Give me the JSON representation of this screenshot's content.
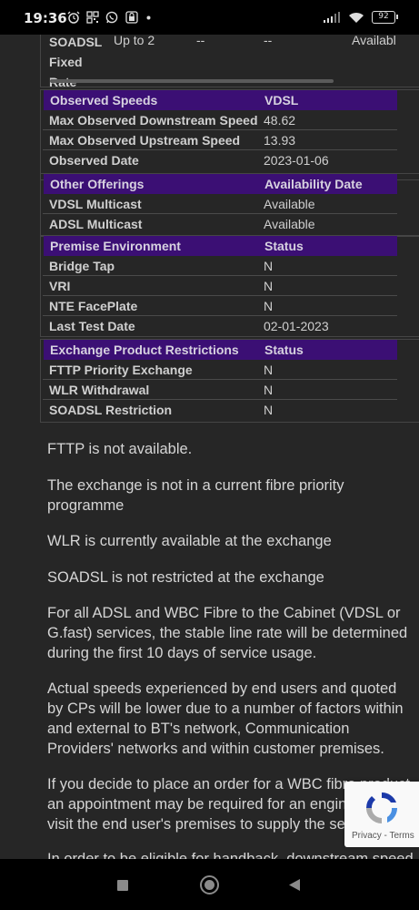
{
  "status_bar": {
    "time": "19:36",
    "battery": "92"
  },
  "top_row": {
    "label_lines": [
      "SOADSL",
      "Fixed",
      "Rate"
    ],
    "value": "Up to 2",
    "col3": "--",
    "col4": "--",
    "col5": "Availabl"
  },
  "observed": {
    "headers": [
      "Observed Speeds",
      "VDSL"
    ],
    "rows": [
      [
        "Max Observed Downstream Speed",
        "48.62"
      ],
      [
        "Max Observed Upstream Speed",
        "13.93"
      ],
      [
        "Observed Date",
        "2023-01-06"
      ]
    ]
  },
  "offerings": {
    "headers": [
      "Other Offerings",
      "Availability Date"
    ],
    "rows": [
      [
        "VDSL Multicast",
        "Available"
      ],
      [
        "ADSL Multicast",
        "Available"
      ]
    ]
  },
  "premise": {
    "headers": [
      "Premise Environment",
      "Status"
    ],
    "rows": [
      [
        "Bridge Tap",
        "N"
      ],
      [
        "VRI",
        "N"
      ],
      [
        "NTE FacePlate",
        "N"
      ],
      [
        "Last Test Date",
        "02-01-2023"
      ]
    ]
  },
  "exchange": {
    "headers": [
      "Exchange Product Restrictions",
      "Status"
    ],
    "rows": [
      [
        "FTTP Priority Exchange",
        "N"
      ],
      [
        "WLR Withdrawal",
        "N"
      ],
      [
        "SOADSL Restriction",
        "N"
      ]
    ]
  },
  "paragraphs": [
    "FTTP is not available.",
    "The exchange is not in a current fibre priority programme",
    "WLR is currently available at the exchange",
    "SOADSL is not restricted at the exchange",
    "For all ADSL and WBC Fibre to the Cabinet (VDSL or G.fast) services, the stable line rate will be determined during the first 10 days of service usage.",
    "Actual speeds experienced by end users and quoted by CPs will be lower due to a number of factors within and external to BT's network, Communication Providers' networks and within customer premises.",
    "If you decide to place an order for a WBC fibre product an appointment may be required for an engineer to visit the end user's premises to supply the service.",
    "In order to be eligible for handback, downstream speed"
  ],
  "recaptcha": {
    "links": "Privacy - Terms"
  },
  "colors": {
    "header_bg": "#3b0f74",
    "page_bg": "#262626"
  },
  "icons": [
    "alarm-icon",
    "grid-icon",
    "whatsapp-icon",
    "lock-icon",
    "signal-icon",
    "wifi-icon",
    "battery-icon",
    "recaptcha-icon",
    "nav-square-icon",
    "nav-home-icon",
    "nav-back-icon"
  ]
}
